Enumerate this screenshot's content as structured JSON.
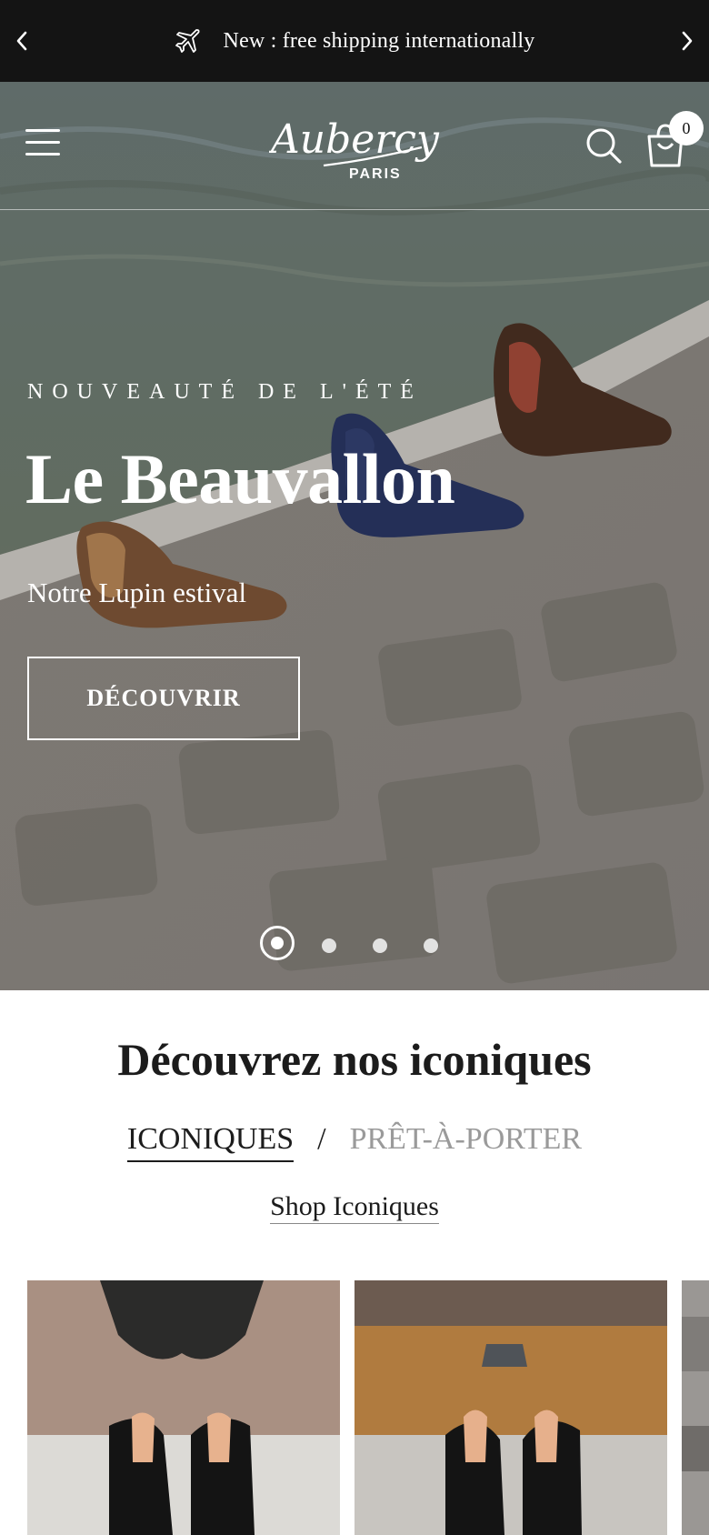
{
  "announcement": {
    "text": "New : free shipping internationally",
    "prev_icon": "chevron-left-icon",
    "next_icon": "chevron-right-icon",
    "leading_icon": "airplane-icon"
  },
  "header": {
    "logo_text": "Aubercy",
    "logo_subtext": "PARIS",
    "cart_count": "0"
  },
  "hero": {
    "eyebrow": "NOUVEAUTÉ DE L'ÉTÉ",
    "title": "Le Beauvallon",
    "subtitle": "Notre Lupin estival",
    "cta": "DÉCOUVRIR",
    "slides_total": 4,
    "active_slide": 1
  },
  "section": {
    "title": "Découvrez nos iconiques",
    "tabs": [
      "ICONIQUES",
      "PRÊT-À-PORTER"
    ],
    "tab_separator": "/",
    "active_tab": "ICONIQUES",
    "shop_link": "Shop Iconiques"
  },
  "colors": {
    "announcement_bg": "#141414",
    "inactive_tab": "#9a9a9a",
    "text": "#1c1c1c"
  }
}
